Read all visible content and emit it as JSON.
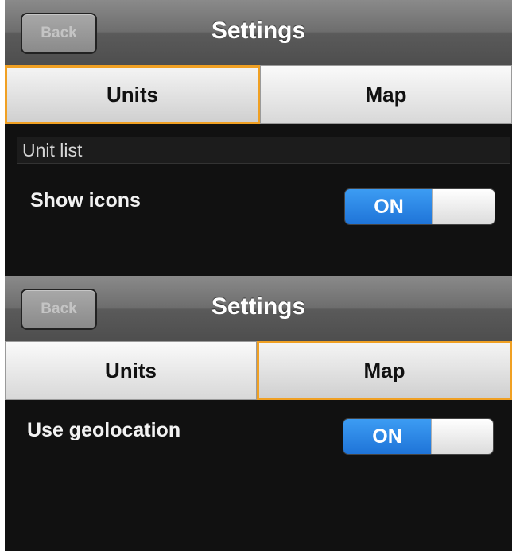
{
  "screen1": {
    "back_label": "Back",
    "title": "Settings",
    "tabs": [
      {
        "label": "Units",
        "active": true
      },
      {
        "label": "Map",
        "active": false
      }
    ],
    "section_header": "Unit list",
    "setting": {
      "label": "Show icons",
      "toggle_value": "ON"
    }
  },
  "screen2": {
    "back_label": "Back",
    "title": "Settings",
    "tabs": [
      {
        "label": "Units",
        "active": false
      },
      {
        "label": "Map",
        "active": true
      }
    ],
    "setting": {
      "label": "Use geolocation",
      "toggle_value": "ON"
    }
  },
  "colors": {
    "active_tab_border": "#f0a023",
    "toggle_on": "#2a86e6",
    "background": "#111111"
  }
}
